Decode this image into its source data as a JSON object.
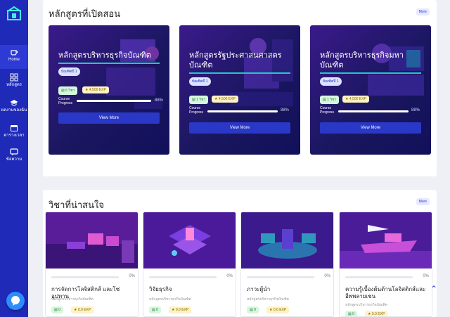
{
  "sidebar": {
    "items": [
      {
        "label": "Home",
        "icon": "coffee-cup-icon"
      },
      {
        "label": "หลักสูตร",
        "icon": "grid-icon"
      },
      {
        "label": "ผลงานของฉัน",
        "icon": "graduation-cap-icon"
      },
      {
        "label": "ตารางเวลา",
        "icon": "calendar-icon"
      },
      {
        "label": "ข้อความ",
        "icon": "message-icon"
      }
    ]
  },
  "courses_section": {
    "title": "หลักสูตรที่เปิดสอน",
    "more_label": "More",
    "courses": [
      {
        "title": "หลักสูตรบริหารธุรกิจบัณฑิต",
        "level": "บัณฑิตปี 1",
        "duration": "6 วิชา",
        "exp": "4,500 EXP",
        "progress_label": "Course Progress",
        "progress": 88,
        "progress_text": "88%",
        "button": "View More"
      },
      {
        "title": "หลักสูตรรัฐประศาสนศาสตรบัณฑิต",
        "level": "บัณฑิตปี 1",
        "duration": "1 วิชา",
        "exp": "4,500 EXP",
        "progress_label": "Course Progress",
        "progress": 88,
        "progress_text": "88%",
        "button": "View More"
      },
      {
        "title": "หลักสูตรบริหารธุรกิจมหาบัณฑิต",
        "level": "บัณฑิตปี 1",
        "duration": "1 วิชา",
        "exp": "4,500 EXP",
        "progress_label": "Course Progress",
        "progress": 88,
        "progress_text": "88%",
        "button": "View More"
      }
    ]
  },
  "subjects_section": {
    "title": "วิชาที่น่าสนใจ",
    "more_label": "More",
    "subjects": [
      {
        "title": "การจัดการโลจิสติกส์ และโซ่อุปทาน",
        "subtitle": "หลักสูตรบริหารธุรกิจบัณฑิต",
        "progress_text": "0%",
        "progress": 0,
        "duration": "0",
        "exp": "0.0 EXP"
      },
      {
        "title": "วิจัยธุรกิจ",
        "subtitle": "หลักสูตรบริหารธุรกิจบัณฑิต",
        "progress_text": "0%",
        "progress": 0,
        "duration": "0",
        "exp": "0.0 EXP"
      },
      {
        "title": "ภาวะผู้นำ",
        "subtitle": "หลักสูตรบริหารธุรกิจบัณฑิต",
        "progress_text": "0%",
        "progress": 0,
        "duration": "0",
        "exp": "0.0 EXP"
      },
      {
        "title": "ความรู้เบื้องต้นด้านโลจิสติกส์และอีพพลายเชน",
        "subtitle": "หลักสูตรบริหารธุรกิจบัณฑิต",
        "progress_text": "0%",
        "progress": 0,
        "duration": "0",
        "exp": "0.0 EXP"
      }
    ]
  },
  "colors": {
    "sidebar": "#1f2bb8",
    "accent": "#2d3ad4",
    "teal": "#25c6c6"
  }
}
